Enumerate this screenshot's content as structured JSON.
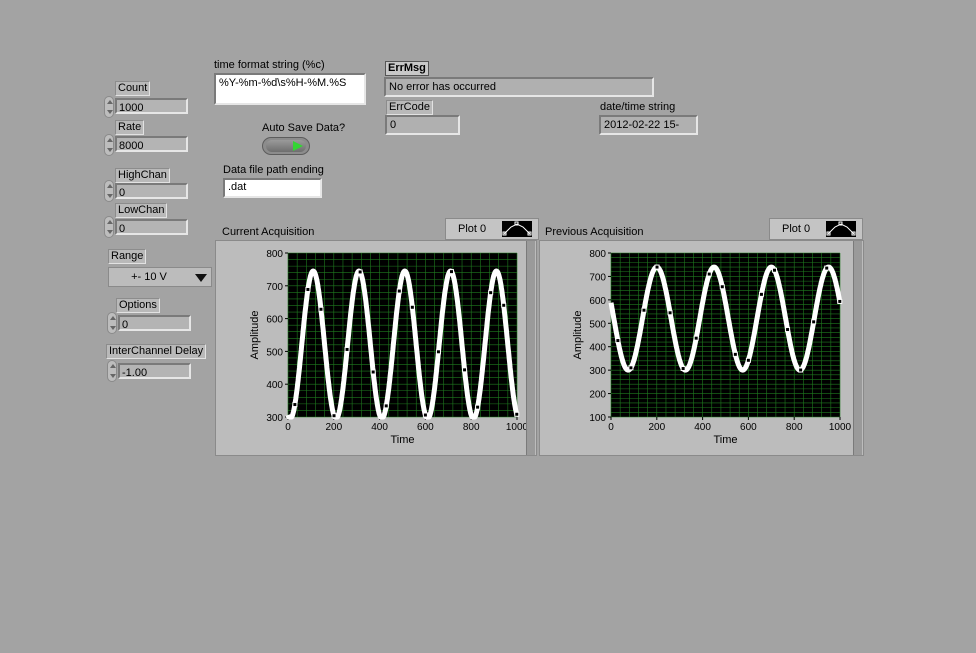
{
  "controls": {
    "count": {
      "label": "Count",
      "value": "1000"
    },
    "rate": {
      "label": "Rate",
      "value": "8000"
    },
    "highchan": {
      "label": "HighChan",
      "value": "0"
    },
    "lowchan": {
      "label": "LowChan",
      "value": "0"
    },
    "range": {
      "label": "Range",
      "value": "+- 10 V"
    },
    "options": {
      "label": "Options",
      "value": "0"
    },
    "interchannel_delay": {
      "label": "InterChannel Delay",
      "value": "-1.00"
    }
  },
  "time_format": {
    "label": "time format string (%c)",
    "value": "%Y-%m-%d\\s%H-%M.%S"
  },
  "auto_save": {
    "label": "Auto Save Data?",
    "on": true
  },
  "data_file": {
    "label": "Data file path ending",
    "value": ".dat"
  },
  "error": {
    "msg_label": "ErrMsg",
    "msg_value": "No error has occurred",
    "code_label": "ErrCode",
    "code_value": "0"
  },
  "datetime": {
    "label": "date/time string",
    "value": "2012-02-22 15-"
  },
  "graphs": [
    {
      "title": "Current Acquisition",
      "legend": "Plot 0",
      "xlabel": "Time",
      "ylabel": "Amplitude"
    },
    {
      "title": "Previous Acquisition",
      "legend": "Plot 0",
      "xlabel": "Time",
      "ylabel": "Amplitude"
    }
  ],
  "colors": {
    "plot_bg": "#000000",
    "grid": "#1f7a1f",
    "trace": "#ffffff",
    "panel": "#a3a3a3"
  },
  "chart_data": [
    {
      "type": "line",
      "title": "Current Acquisition",
      "xlabel": "Time",
      "ylabel": "Amplitude",
      "xlim": [
        0,
        1000
      ],
      "ylim": [
        300,
        800
      ],
      "xticks": [
        0,
        200,
        400,
        600,
        800,
        1000
      ],
      "yticks": [
        300,
        400,
        500,
        600,
        700,
        800
      ],
      "grid": true,
      "series": [
        {
          "name": "Plot 0",
          "offset": 520,
          "amplitude": 225,
          "period": 200,
          "peak_x": 110
        }
      ]
    },
    {
      "type": "line",
      "title": "Previous Acquisition",
      "xlabel": "Time",
      "ylabel": "Amplitude",
      "xlim": [
        0,
        1000
      ],
      "ylim": [
        100,
        800
      ],
      "xticks": [
        0,
        200,
        400,
        600,
        800,
        1000
      ],
      "yticks": [
        100,
        200,
        300,
        400,
        500,
        600,
        700,
        800
      ],
      "grid": true,
      "series": [
        {
          "name": "Plot 0",
          "offset": 520,
          "amplitude": 220,
          "period": 250,
          "peak_x": 200
        }
      ]
    }
  ]
}
